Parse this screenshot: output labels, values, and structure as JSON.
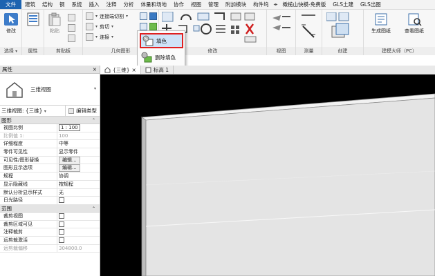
{
  "menubar": {
    "tabs": [
      "文件",
      "建筑",
      "结构",
      "钢",
      "系统",
      "插入",
      "注释",
      "分析",
      "体量和场地",
      "协作",
      "视图",
      "管理",
      "附加模块",
      "构件坞",
      "橄榄山快模-免费版",
      "GLS土建",
      "GLS出图"
    ]
  },
  "ribbon": {
    "modify_label": "修改",
    "select_label": "选择",
    "properties_label": "属性",
    "clipboard": {
      "paste_label": "粘贴",
      "panel_label": "剪贴板"
    },
    "geometry": {
      "cope_label": "连接端切割",
      "cut_label": "剪切",
      "join_label": "连接",
      "panel_label": "几何图形"
    },
    "modify_panel_label": "修改",
    "view_panel_label": "视图",
    "measure_panel_label": "测量",
    "create_panel_label": "创建",
    "generate_sheet_label": "生成图纸",
    "view_sheet_label": "查看图纸",
    "architect_panel_label": "建模大师（PC）"
  },
  "popup": {
    "items": [
      "填色",
      "删除填色"
    ]
  },
  "properties": {
    "title": "属性",
    "close": "×",
    "type_name": "三维视图",
    "instance_label": "三维视图: {三维}",
    "edit_type_label": "编辑类型",
    "groups": [
      {
        "name": "图形",
        "rows": [
          {
            "name": "视图比例",
            "value": "1 : 100"
          },
          {
            "name": "比例值 1:",
            "value": "100"
          },
          {
            "name": "详细程度",
            "value": "中等"
          },
          {
            "name": "零件可见性",
            "value": "显示零件"
          },
          {
            "name": "可见性/图形替换",
            "value": "编辑..."
          },
          {
            "name": "图形显示选项",
            "value": "编辑..."
          },
          {
            "name": "规程",
            "value": "协调"
          },
          {
            "name": "显示隐藏线",
            "value": "按规程"
          },
          {
            "name": "默认分析显示样式",
            "value": "无"
          },
          {
            "name": "日光路径",
            "value": ""
          }
        ]
      },
      {
        "name": "范围",
        "rows": [
          {
            "name": "裁剪视图",
            "value": ""
          },
          {
            "name": "裁剪区域可见",
            "value": ""
          },
          {
            "name": "注释裁剪",
            "value": ""
          },
          {
            "name": "远剪裁激活",
            "value": ""
          },
          {
            "name": "远剪裁偏移",
            "value": "304800.0"
          }
        ]
      }
    ]
  },
  "view_tabs": [
    {
      "label": "{三维}",
      "active": true
    },
    {
      "label": "标高 1",
      "active": false
    }
  ],
  "colors": {
    "accent": "#1d63b0",
    "highlight_border": "#e02020",
    "viewport_bg": "#000000",
    "wall_face": "#e4e4e4"
  }
}
